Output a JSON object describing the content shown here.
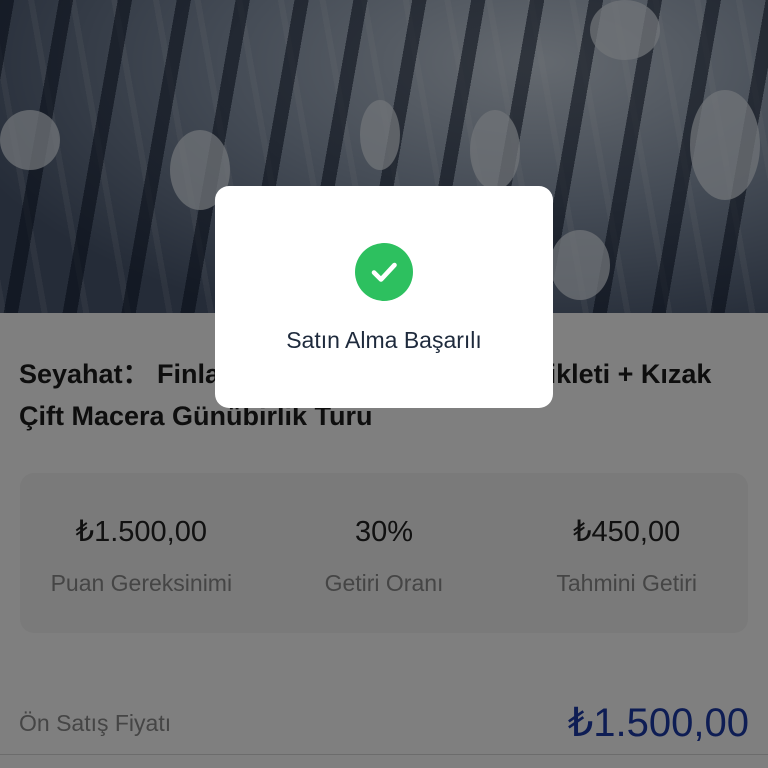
{
  "product": {
    "title": "Seyahat： Finlandiya Laponya Kar Motosikleti + Kızak Çift Macera Günübirlik Turu"
  },
  "stats": [
    {
      "value": "₺1.500,00",
      "label": "Puan Gereksinimi"
    },
    {
      "value": "30%",
      "label": "Getiri Oranı"
    },
    {
      "value": "₺450,00",
      "label": "Tahmini Getiri"
    }
  ],
  "presale": {
    "label": "Ön Satış Fiyatı",
    "price": "₺1.500,00"
  },
  "toast": {
    "message": "Satın Alma Başarılı",
    "icon": "check-circle-icon"
  },
  "colors": {
    "accent_price": "#1d3aa8",
    "success": "#2dc05f",
    "overlay": "rgba(0,0,0,0.5)"
  }
}
